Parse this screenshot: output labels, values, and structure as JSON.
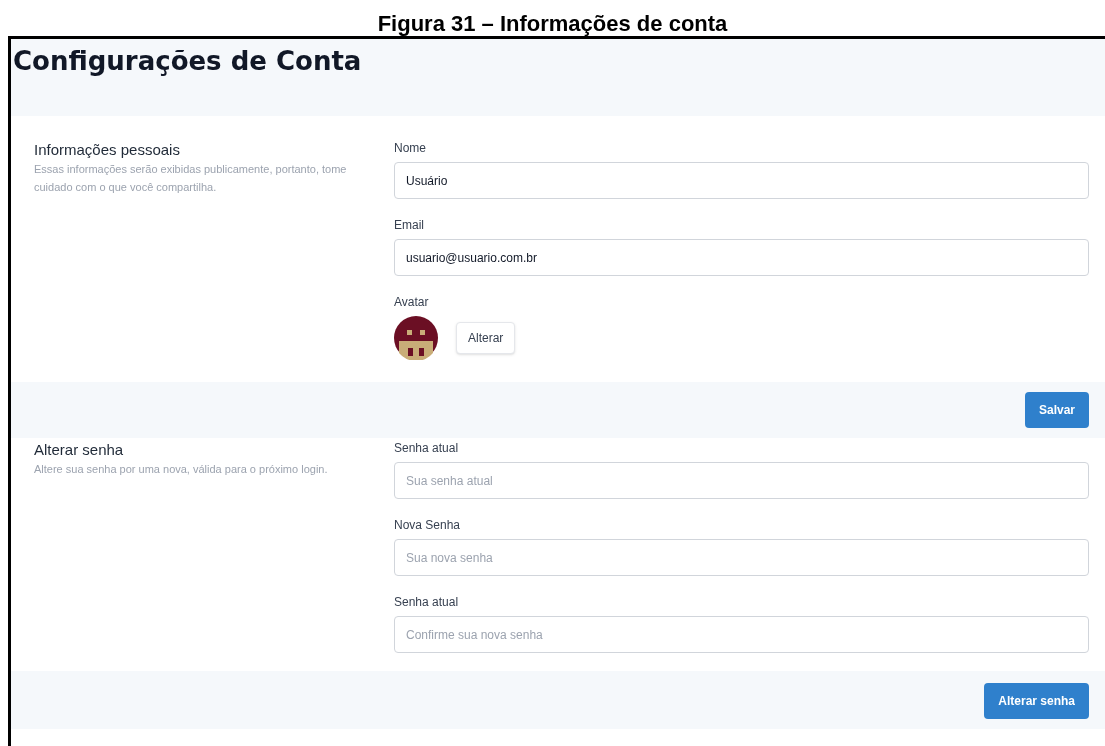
{
  "caption": "Figura 31 – Informações de conta",
  "page": {
    "title": "Configurações de Conta"
  },
  "sections": [
    {
      "title": "Informações pessoais",
      "description": "Essas informações serão exibidas publicamente, portanto, tome cuidado com o que você compartilha.",
      "fields": [
        {
          "kind": "input",
          "label": "Nome",
          "value": "Usuário"
        },
        {
          "kind": "input",
          "label": "Email",
          "value": "usuario@usuario.com.br"
        },
        {
          "kind": "avatar",
          "label": "Avatar",
          "button": "Alterar"
        }
      ],
      "action": "Salvar"
    },
    {
      "title": "Alterar senha",
      "description": "Altere sua senha por uma nova, válida para o próximo login.",
      "fields": [
        {
          "kind": "input",
          "label": "Senha atual",
          "placeholder": "Sua senha atual"
        },
        {
          "kind": "input",
          "label": "Nova Senha",
          "placeholder": "Sua nova senha"
        },
        {
          "kind": "input",
          "label": "Senha atual",
          "placeholder": "Confirme sua nova senha"
        }
      ],
      "action": "Alterar senha"
    }
  ]
}
